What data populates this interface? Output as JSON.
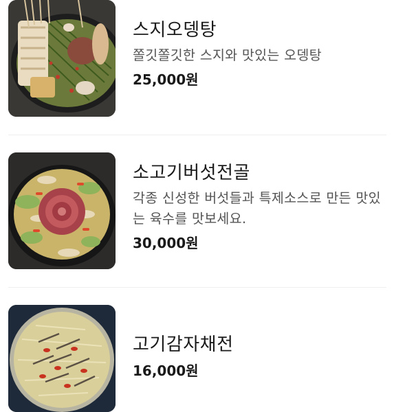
{
  "menu": {
    "items": [
      {
        "name": "스지오뎅탕",
        "description": "쫄깃쫄깃한 스지와 맛있는 오뎅탕",
        "price": "25,000원",
        "image": "fishcake-beef-tendon-hotpot-photo"
      },
      {
        "name": "소고기버섯전골",
        "description": "각종 신성한 버섯들과 특제소스로 만든 맛있는 육수를 맛보세요.",
        "price": "30,000원",
        "image": "beef-mushroom-hotpot-photo"
      },
      {
        "name": "고기감자채전",
        "description": "",
        "price": "16,000원",
        "image": "meat-potato-pancake-photo"
      }
    ]
  },
  "colors": {
    "text_primary": "#1a1a1a",
    "text_secondary": "#555555",
    "divider": "#eeeeee"
  }
}
